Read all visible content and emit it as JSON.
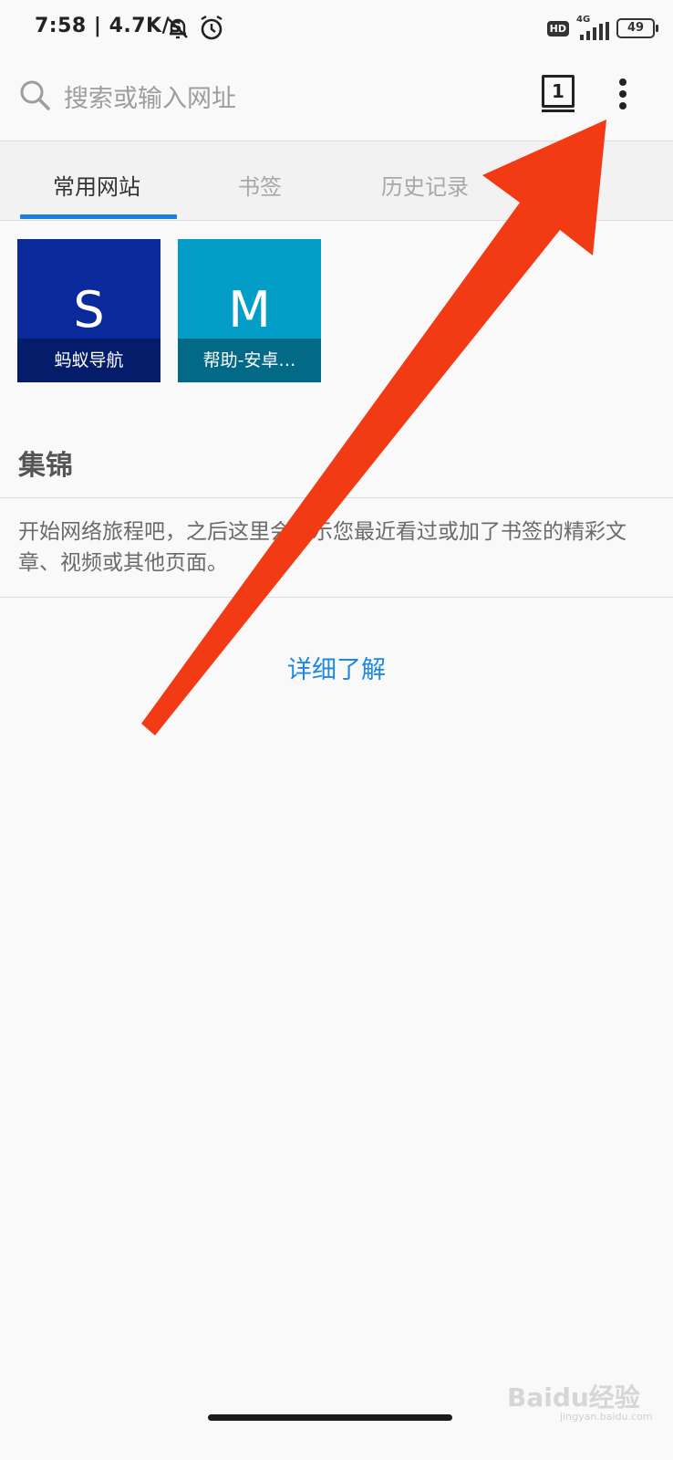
{
  "status_bar": {
    "text": "7:58 | 4.7K/s",
    "network": "4G",
    "hd": "HD",
    "battery": "49"
  },
  "toolbar": {
    "search_placeholder": "搜索或输入网址",
    "tab_count": "1",
    "icons": [
      "search-icon",
      "tabs-icon",
      "more-menu-icon"
    ]
  },
  "tabs": [
    {
      "label": "常用网站",
      "active": true
    },
    {
      "label": "书签",
      "active": false
    },
    {
      "label": "历史记录",
      "active": false
    }
  ],
  "top_sites": [
    {
      "letter": "S",
      "label": "蚂蚁导航",
      "color": "#0a2a9c"
    },
    {
      "letter": "M",
      "label": "帮助-安卓…",
      "color": "#029ec8"
    }
  ],
  "highlights": {
    "title": "集锦",
    "description": "开始网络旅程吧，之后这里会显示您最近看过或加了书签的精彩文章、视频或其他页面。",
    "learn_more": "详细了解"
  },
  "colors": {
    "accent": "#1e7be4",
    "arrow": "#f23a14"
  },
  "watermark": {
    "text": "Baidu经验",
    "sub": "jingyan.baidu.com"
  }
}
